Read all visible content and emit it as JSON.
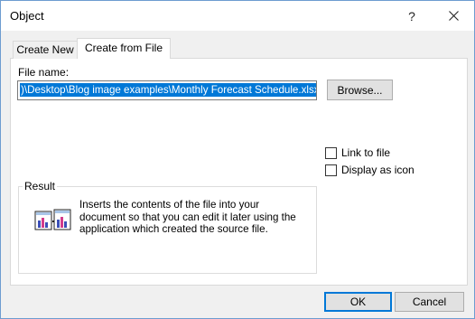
{
  "window": {
    "title": "Object",
    "help_glyph": "?",
    "close_icon": "close-icon"
  },
  "tabs": [
    {
      "label": "Create New",
      "active": false
    },
    {
      "label": "Create from File",
      "active": true
    }
  ],
  "file_name": {
    "label": "File name:",
    "value": ")\\Desktop\\Blog image examples\\Monthly Forecast Schedule.xlsx"
  },
  "browse_label": "Browse...",
  "options": {
    "link_to_file": {
      "label": "Link to file",
      "checked": false
    },
    "display_as_icon": {
      "label": "Display as icon",
      "checked": false
    }
  },
  "result": {
    "legend": "Result",
    "icon": "embed-object-icon",
    "text": "Inserts the contents of the file into your document so that you can edit it later using the application which created the source file."
  },
  "buttons": {
    "ok": "OK",
    "cancel": "Cancel"
  },
  "colors": {
    "accent": "#0078d7",
    "selection_text": "#ffffff"
  }
}
